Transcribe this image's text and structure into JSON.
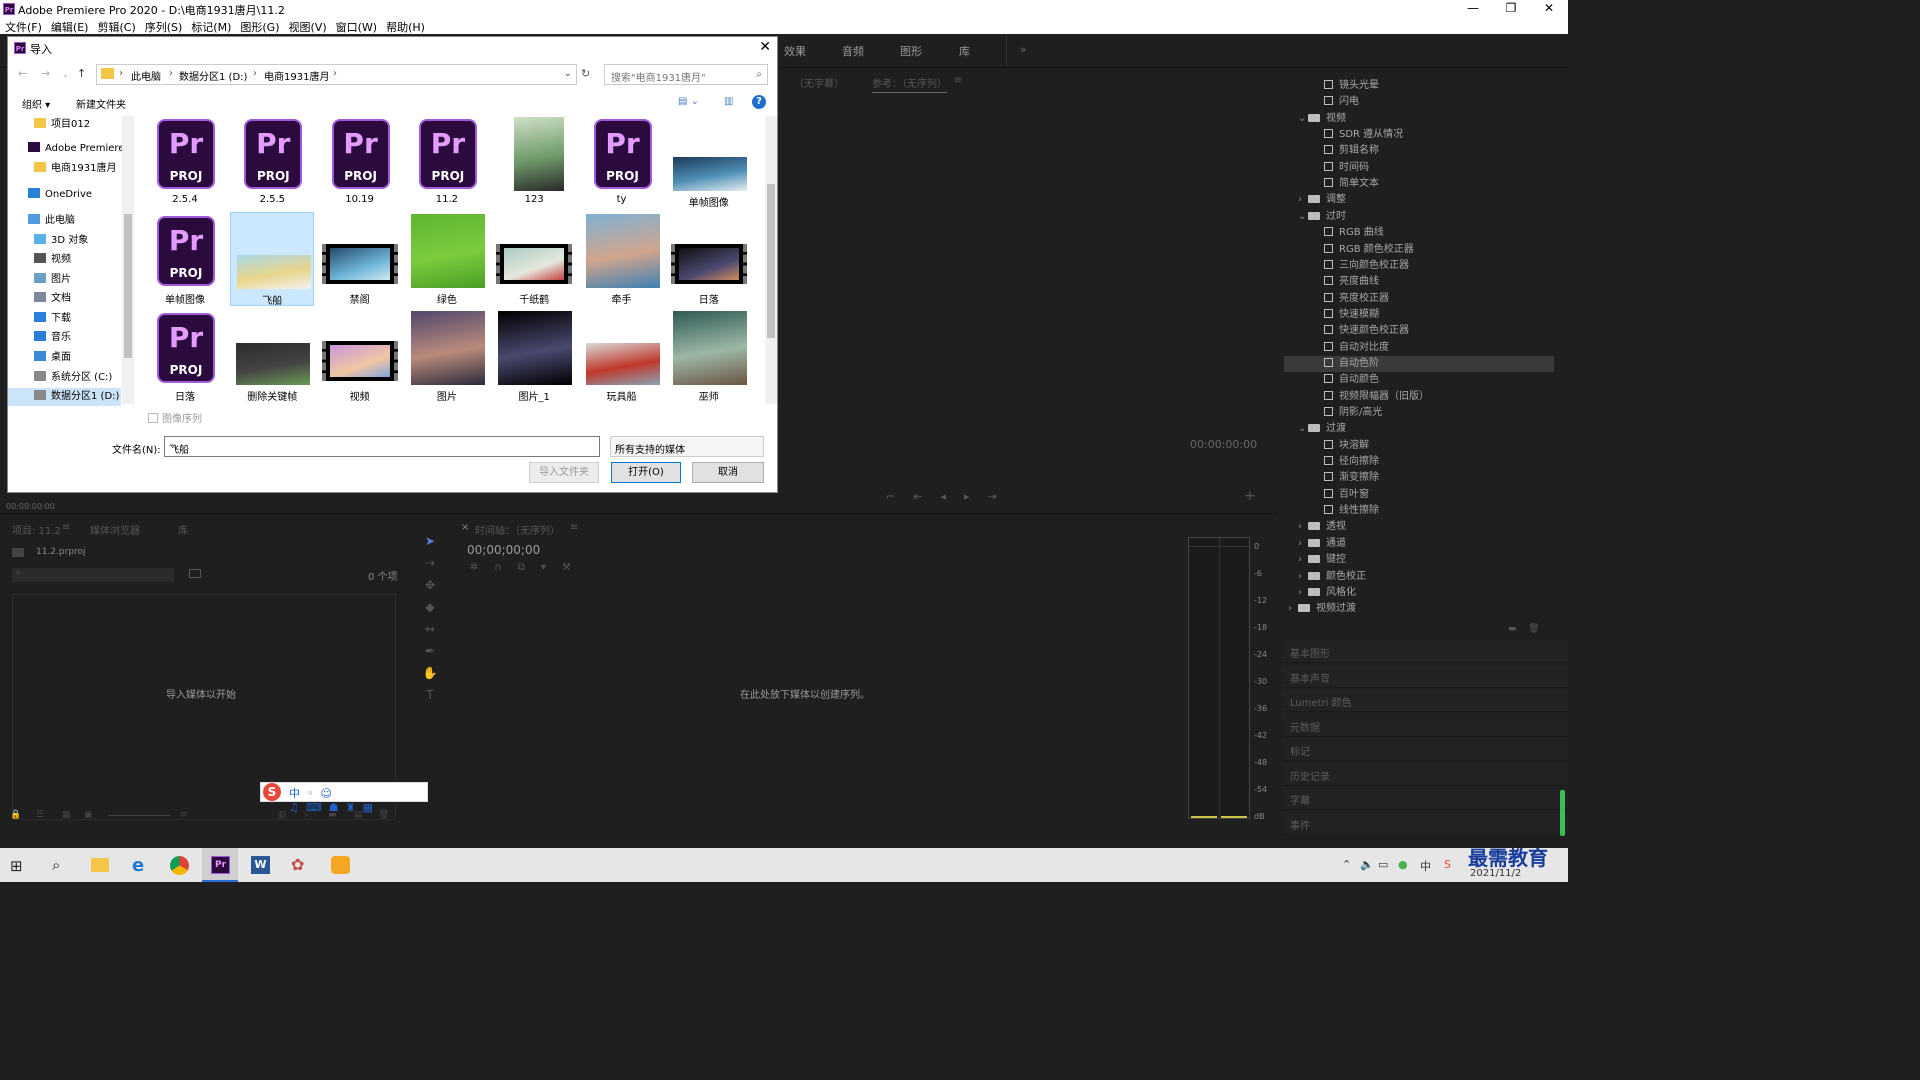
{
  "app": {
    "window_title": "Adobe Premiere Pro 2020 - D:\\电商1931唐月\\11.2",
    "logo_text": "Pr",
    "menu": [
      "文件(F)",
      "编辑(E)",
      "剪辑(C)",
      "序列(S)",
      "标记(M)",
      "图形(G)",
      "视图(V)",
      "窗口(W)",
      "帮助(H)"
    ],
    "window_controls": [
      "—",
      "❐",
      "✕"
    ]
  },
  "workspaces": [
    "效果",
    "音频",
    "图形",
    "库",
    "»"
  ],
  "program": {
    "tabs": [
      "（无字幕）",
      "参考：（无序列）",
      "≡"
    ],
    "timecode": "00:00:00:00",
    "left_timecode": "00:00:00:00"
  },
  "effects_tree": {
    "rows": [
      {
        "label": "镜头光晕",
        "indent": 3,
        "kind": "fx"
      },
      {
        "label": "闪电",
        "indent": 3,
        "kind": "fx"
      },
      {
        "label": "视频",
        "indent": 2,
        "kind": "folder",
        "chev": "⌄"
      },
      {
        "label": "SDR 遵从情况",
        "indent": 3,
        "kind": "fx"
      },
      {
        "label": "剪辑名称",
        "indent": 3,
        "kind": "fx"
      },
      {
        "label": "时间码",
        "indent": 3,
        "kind": "fx"
      },
      {
        "label": "简单文本",
        "indent": 3,
        "kind": "fx"
      },
      {
        "label": "调整",
        "indent": 2,
        "kind": "folder",
        "chev": "›"
      },
      {
        "label": "过时",
        "indent": 2,
        "kind": "folder",
        "chev": "⌄"
      },
      {
        "label": "RGB 曲线",
        "indent": 3,
        "kind": "fx"
      },
      {
        "label": "RGB 颜色校正器",
        "indent": 3,
        "kind": "fx"
      },
      {
        "label": "三向颜色校正器",
        "indent": 3,
        "kind": "fx"
      },
      {
        "label": "亮度曲线",
        "indent": 3,
        "kind": "fx"
      },
      {
        "label": "亮度校正器",
        "indent": 3,
        "kind": "fx"
      },
      {
        "label": "快速模糊",
        "indent": 3,
        "kind": "fx"
      },
      {
        "label": "快速颜色校正器",
        "indent": 3,
        "kind": "fx"
      },
      {
        "label": "自动对比度",
        "indent": 3,
        "kind": "fx"
      },
      {
        "label": "自动色阶",
        "indent": 3,
        "kind": "fx",
        "selected": true
      },
      {
        "label": "自动颜色",
        "indent": 3,
        "kind": "fx"
      },
      {
        "label": "视频限幅器（旧版）",
        "indent": 3,
        "kind": "fx"
      },
      {
        "label": "阴影/高光",
        "indent": 3,
        "kind": "fx"
      },
      {
        "label": "过渡",
        "indent": 2,
        "kind": "folder",
        "chev": "⌄"
      },
      {
        "label": "块溶解",
        "indent": 3,
        "kind": "fx"
      },
      {
        "label": "径向擦除",
        "indent": 3,
        "kind": "fx"
      },
      {
        "label": "渐变擦除",
        "indent": 3,
        "kind": "fx"
      },
      {
        "label": "百叶窗",
        "indent": 3,
        "kind": "fx"
      },
      {
        "label": "线性擦除",
        "indent": 3,
        "kind": "fx"
      },
      {
        "label": "透视",
        "indent": 2,
        "kind": "folder",
        "chev": "›"
      },
      {
        "label": "通道",
        "indent": 2,
        "kind": "folder",
        "chev": "›"
      },
      {
        "label": "键控",
        "indent": 2,
        "kind": "folder",
        "chev": "›"
      },
      {
        "label": "颜色校正",
        "indent": 2,
        "kind": "folder",
        "chev": "›"
      },
      {
        "label": "风格化",
        "indent": 2,
        "kind": "folder",
        "chev": "›"
      },
      {
        "label": "视频过渡",
        "indent": 1,
        "kind": "folder",
        "chev": "›"
      }
    ]
  },
  "side_panels": [
    "基本图形",
    "基本声音",
    "Lumetri 颜色",
    "元数据",
    "标记",
    "历史记录",
    "字幕",
    "事件"
  ],
  "project_panel": {
    "tabs": [
      "项目: 11.2",
      "≡",
      "媒体浏览器",
      "库"
    ],
    "file": "11.2.prproj",
    "count": "0 个项",
    "empty_hint": "导入媒体以开始"
  },
  "timeline": {
    "tab": "时间轴：（无序列）",
    "menu": "≡",
    "close": "×",
    "timecode": "00;00;00;00",
    "hint": "在此处放下媒体以创建序列。"
  },
  "meter_ticks": [
    "0",
    "-6",
    "-12",
    "-18",
    "-24",
    "-30",
    "-36",
    "-42",
    "-48",
    "-54",
    "dB"
  ],
  "dialog": {
    "title": "导入",
    "close": "✕",
    "breadcrumb": [
      "此电脑",
      "数据分区1 (D:)",
      "电商1931唐月"
    ],
    "search_placeholder": "搜索\"电商1931唐月\"",
    "toolbar": {
      "organize": "组织 ▾",
      "new_folder": "新建文件夹"
    },
    "sidebar": [
      {
        "label": "项目012",
        "icon": "folder"
      },
      {
        "label": "Adobe Premiere",
        "icon": "pr"
      },
      {
        "label": "电商1931唐月",
        "icon": "folder"
      },
      {
        "label": "OneDrive",
        "icon": "cloud"
      },
      {
        "label": "此电脑",
        "icon": "pc"
      },
      {
        "label": "3D 对象",
        "icon": "cube"
      },
      {
        "label": "视频",
        "icon": "video"
      },
      {
        "label": "图片",
        "icon": "picture"
      },
      {
        "label": "文档",
        "icon": "doc"
      },
      {
        "label": "下载",
        "icon": "download"
      },
      {
        "label": "音乐",
        "icon": "music"
      },
      {
        "label": "桌面",
        "icon": "desktop"
      },
      {
        "label": "系统分区 (C:)",
        "icon": "drive"
      },
      {
        "label": "数据分区1 (D:)",
        "icon": "drive",
        "selected": true
      }
    ],
    "files": [
      {
        "name": "2.5.4",
        "type": "proj"
      },
      {
        "name": "2.5.5",
        "type": "proj"
      },
      {
        "name": "10.19",
        "type": "proj"
      },
      {
        "name": "11.2",
        "type": "proj"
      },
      {
        "name": "123",
        "type": "image",
        "colors": [
          "#cfe0c8",
          "#6f9a6a",
          "#2a2a2a"
        ]
      },
      {
        "name": "ty",
        "type": "proj"
      },
      {
        "name": "单帧图像",
        "type": "image",
        "colors": [
          "#1c3b5a",
          "#4f8fb5",
          "#e8eef2"
        ]
      },
      {
        "name": "单帧图像",
        "type": "proj"
      },
      {
        "name": "飞船",
        "type": "image",
        "colors": [
          "#a9d8e8",
          "#e9d58a",
          "#f2f2f2"
        ],
        "selected": true
      },
      {
        "name": "禁阁",
        "type": "film",
        "colors": [
          "#244b6b",
          "#6fb6d9",
          "#d0e8f2"
        ]
      },
      {
        "name": "绿色",
        "type": "image",
        "colors": [
          "#5eb52f",
          "#7ccb3d",
          "#4a9e24"
        ]
      },
      {
        "name": "千纸鹤",
        "type": "film",
        "colors": [
          "#a9c9c3",
          "#e5e8dc",
          "#c33e3e"
        ]
      },
      {
        "name": "牵手",
        "type": "image",
        "colors": [
          "#7fb1d3",
          "#d0a58e",
          "#3f7fb0"
        ]
      },
      {
        "name": "日落",
        "type": "film",
        "colors": [
          "#111111",
          "#4a4970",
          "#d18d5f"
        ]
      },
      {
        "name": "日落",
        "type": "proj"
      },
      {
        "name": "删除关键帧",
        "type": "image",
        "colors": [
          "#2c2c2c",
          "#444444",
          "#6a9a55"
        ]
      },
      {
        "name": "视频",
        "type": "film",
        "colors": [
          "#c996d8",
          "#f1c6a2",
          "#7ea3de"
        ]
      },
      {
        "name": "图片",
        "type": "image",
        "colors": [
          "#53486e",
          "#b98a7b",
          "#2a2a3a"
        ]
      },
      {
        "name": "图片_1",
        "type": "image",
        "colors": [
          "#000000",
          "#4a4970",
          "#000000"
        ]
      },
      {
        "name": "玩具船",
        "type": "image",
        "colors": [
          "#d9d9d9",
          "#c0392b",
          "#8aa2b5"
        ]
      },
      {
        "name": "巫师",
        "type": "image",
        "colors": [
          "#2e5b55",
          "#9db7a5",
          "#6b5544"
        ]
      }
    ],
    "image_sequence": "图像序列",
    "filename_label": "文件名(N):",
    "filename_value": "飞船",
    "filetype_value": "所有支持的媒体",
    "buttons": {
      "import_folder": "导入文件夹",
      "open": "打开(O)",
      "cancel": "取消"
    }
  },
  "taskbar": {
    "tray_clock_date": "2021/11/2",
    "watermark": "最需教育"
  }
}
